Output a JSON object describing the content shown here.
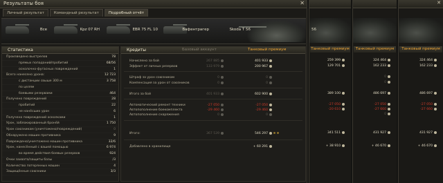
{
  "window": {
    "title": "Результаты боя",
    "close_symbol": "✕"
  },
  "tabs": [
    {
      "label": "Личный результат",
      "active": false
    },
    {
      "label": "Командный результат",
      "active": false
    },
    {
      "label": "Подробный отчёт",
      "active": true
    }
  ],
  "vehicles": [
    "Все",
    "Kpz 07 RH",
    "EBR 75 FL 10",
    "Вафентрагер",
    "Skoda T 56"
  ],
  "stats_panel": {
    "title": "Статистика",
    "rows": [
      {
        "label": "Произведено выстрелов",
        "value": "78"
      },
      {
        "label": "прямых попаданий/пробитий",
        "value": "68/56"
      },
      {
        "label": "осколочно-фугасных повреждений",
        "value": "1"
      },
      {
        "label": "Всего нанесено урона:",
        "value": "12 723"
      },
      {
        "label": "с дистанции свыше 300 м",
        "value": "3 758"
      },
      {
        "label": "по целям",
        "value": ""
      },
      {
        "label": "боевыми резервами",
        "value": "464"
      },
      {
        "label": "Получено повреждений",
        "value": "28"
      },
      {
        "label": "пробитий",
        "value": "22"
      },
      {
        "label": "не нанёсших урон",
        "value": "6"
      },
      {
        "label": "Получено повреждений осколками",
        "value": "1"
      },
      {
        "label": "Урон, заблокированный бронёй",
        "value": "1 750"
      },
      {
        "label": "Урон союзникам (уничтожено/повреждений)",
        "value": "0"
      },
      {
        "label": "Обнаружено машин противника",
        "value": "9"
      },
      {
        "label": "Повреждено/уничтожено машин противника",
        "value": "32/6"
      },
      {
        "label": "Урон, нанесённый с вашей помощью",
        "value": "6 974"
      },
      {
        "label": "во время действия боевых резервов",
        "value": "924"
      },
      {
        "label": "Очки захвата/защиты базы",
        "value": "/3"
      },
      {
        "label": "Количество потерянных машин",
        "value": "4"
      },
      {
        "label": "Защищённые союзники",
        "value": "3/3"
      }
    ]
  },
  "credits_panel": {
    "title": "Кредиты",
    "col_base": "Базовый аккаунт",
    "col_premium": "Танковый премиум",
    "rows": [
      {
        "label": "Начислено за бой",
        "base": "267 885",
        "premium": "401 933"
      },
      {
        "label": "Эффект от личных резервов",
        "base": "133 979",
        "premium": "200 967"
      },
      {
        "label": "Штраф за урон союзникам",
        "base": "0",
        "premium": "0"
      },
      {
        "label": "Компенсация за урон от союзников",
        "base": "0",
        "premium": "0"
      },
      {
        "label": "Итого за бой",
        "base": "401 933",
        "premium": "602 900"
      },
      {
        "label": "Автоматический ремонт техники",
        "base": "-27 050",
        "premium": "-27 050"
      },
      {
        "label": "Автопополнение боекомплекта",
        "base": "-29 460",
        "premium": "-29 460"
      },
      {
        "label": "Автопополнение снаряжения",
        "base": "0",
        "premium": "0"
      },
      {
        "label": "Итого:",
        "base": "367 539",
        "premium": "546 297"
      },
      {
        "label": "Добавлено в хранилище",
        "base": "",
        "premium": "+ 60 291"
      }
    ]
  },
  "side_panels": [
    {
      "vehicle": "56",
      "header": "Танковый премиум",
      "values": [
        "259 399",
        "129 701",
        "",
        "",
        "389 100",
        "-27 050",
        "-20 610",
        "",
        "341 511",
        "+ 38 910"
      ]
    },
    {
      "vehicle": "",
      "header": "Танковый премиум",
      "values": [
        "324 464",
        "162 233",
        "0",
        "0",
        "486 697",
        "-27 050",
        "-27 660",
        "0",
        "431 927",
        "+ 46 670"
      ]
    },
    {
      "vehicle": "",
      "header": "Танковый премиум",
      "values": [
        "",
        "",
        "",
        "",
        "",
        "",
        "",
        "",
        "",
        ""
      ]
    }
  ],
  "colors": {
    "accent": "#f2a734",
    "negative": "#d33a2a",
    "text": "#c9c4b4"
  }
}
